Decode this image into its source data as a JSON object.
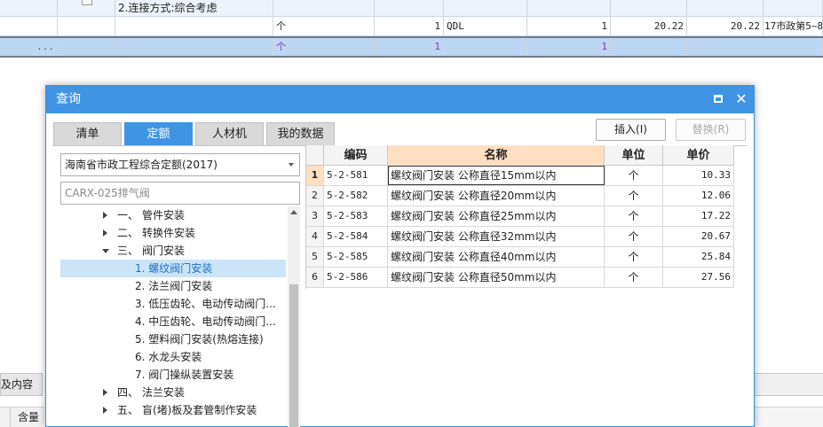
{
  "background": {
    "row1": {
      "desc": "2.连接方式:综合考虑"
    },
    "row2": {
      "unit": "个",
      "qty": "1",
      "code": "QDL",
      "qty2": "1",
      "price1": "20.22",
      "price2": "20.22",
      "note": "17市政第5~8"
    },
    "row3": {
      "dots": "...",
      "unit": "个",
      "qty": "1",
      "qty2": "1"
    },
    "bottom_tab": "及内容",
    "bottom_col": "含量"
  },
  "dialog": {
    "title": "查询",
    "tabs": [
      {
        "label": "清单"
      },
      {
        "label": "定额"
      },
      {
        "label": "人材机"
      },
      {
        "label": "我的数据"
      }
    ],
    "insert_label": "插入(I)",
    "replace_label": "替换(R)",
    "quota_select": "海南省市政工程综合定额(2017)",
    "search_value": "CARX-025排气阀",
    "tree": [
      {
        "num": "一、",
        "label": "管件安装"
      },
      {
        "num": "二、",
        "label": "转换件安装"
      },
      {
        "num": "三、",
        "label": "阀门安装"
      },
      {
        "label": "1. 螺纹阀门安装"
      },
      {
        "label": "2. 法兰阀门安装"
      },
      {
        "label": "3. 低压齿轮、电动传动阀门..."
      },
      {
        "label": "4. 中压齿轮、电动传动阀门..."
      },
      {
        "label": "5. 塑料阀门安装(热熔连接)"
      },
      {
        "label": "6. 水龙头安装"
      },
      {
        "label": "7. 阀门操纵装置安装"
      },
      {
        "num": "四、",
        "label": "法兰安装"
      },
      {
        "num": "五、",
        "label": "盲(堵)板及套管制作安装"
      }
    ],
    "table": {
      "headers": {
        "code": "编码",
        "name": "名称",
        "unit": "单位",
        "price": "单价"
      },
      "rows": [
        {
          "no": "1",
          "code": "5-2-581",
          "name": "螺纹阀门安装 公称直径15mm以内",
          "unit": "个",
          "price": "10.33"
        },
        {
          "no": "2",
          "code": "5-2-582",
          "name": "螺纹阀门安装 公称直径20mm以内",
          "unit": "个",
          "price": "12.06"
        },
        {
          "no": "3",
          "code": "5-2-583",
          "name": "螺纹阀门安装 公称直径25mm以内",
          "unit": "个",
          "price": "17.22"
        },
        {
          "no": "4",
          "code": "5-2-584",
          "name": "螺纹阀门安装 公称直径32mm以内",
          "unit": "个",
          "price": "20.67"
        },
        {
          "no": "5",
          "code": "5-2-585",
          "name": "螺纹阀门安装 公称直径40mm以内",
          "unit": "个",
          "price": "25.84"
        },
        {
          "no": "6",
          "code": "5-2-586",
          "name": "螺纹阀门安装 公称直径50mm以内",
          "unit": "个",
          "price": "27.56"
        }
      ]
    }
  }
}
